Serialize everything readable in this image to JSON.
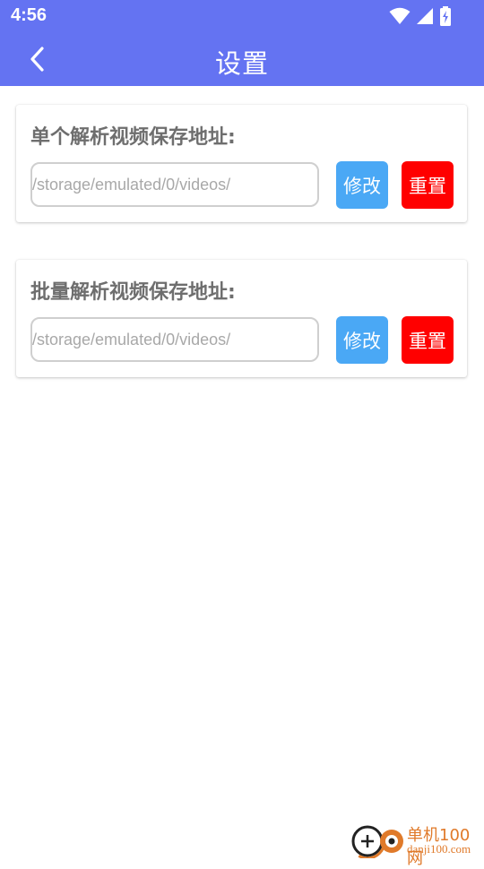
{
  "status_bar": {
    "time": "4:56",
    "icons": [
      "wifi-icon",
      "signal-icon",
      "battery-charging-icon"
    ]
  },
  "app_bar": {
    "title": "设置",
    "back_icon": "chevron-left-icon",
    "background": "#6473f2"
  },
  "single_card": {
    "title": "单个解析视频保存地址:",
    "path_value": "/storage/emulated/0/videos/",
    "edit_label": "修改",
    "reset_label": "重置"
  },
  "batch_card": {
    "title": "批量解析视频保存地址:",
    "path_value": "/storage/emulated/0/videos/",
    "edit_label": "修改",
    "reset_label": "重置"
  },
  "colors": {
    "accent": "#6473f2",
    "edit_button": "#4aa8f5",
    "reset_button": "#ff0000"
  },
  "watermark": {
    "name": "单机100网",
    "url": "danji100.com"
  }
}
